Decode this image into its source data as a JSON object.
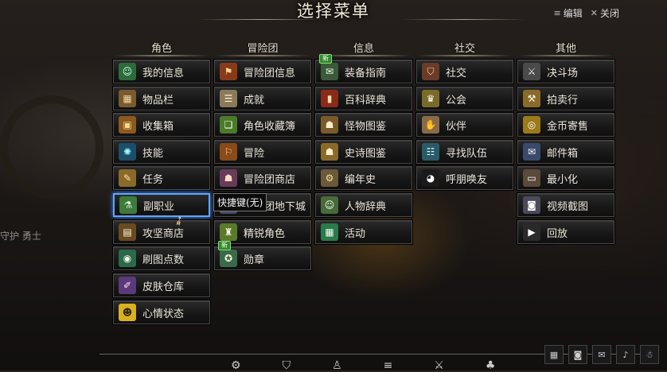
{
  "header": {
    "title": "选择菜单",
    "edit_label": "编辑",
    "close_label": "关闭"
  },
  "columns": [
    {
      "title": "角色"
    },
    {
      "title": "冒险团"
    },
    {
      "title": "信息"
    },
    {
      "title": "社交"
    },
    {
      "title": "其他"
    }
  ],
  "menu": {
    "character": [
      {
        "label": "我的信息",
        "icon": "person-icon"
      },
      {
        "label": "物品栏",
        "icon": "inventory-icon"
      },
      {
        "label": "收集箱",
        "icon": "chest-icon"
      },
      {
        "label": "技能",
        "icon": "skill-icon"
      },
      {
        "label": "任务",
        "icon": "quest-icon"
      },
      {
        "label": "副职业",
        "icon": "potion-icon"
      },
      {
        "label": "攻坚商店",
        "icon": "shop-icon"
      },
      {
        "label": "刷图点数",
        "icon": "points-icon"
      },
      {
        "label": "皮肤仓库",
        "icon": "brush-icon"
      },
      {
        "label": "心情状态",
        "icon": "emoji-icon"
      }
    ],
    "adventure": [
      {
        "label": "冒险团信息",
        "icon": "banner-icon"
      },
      {
        "label": "成就",
        "icon": "scroll-icon"
      },
      {
        "label": "角色收藏簿",
        "icon": "cards-icon"
      },
      {
        "label": "冒险",
        "icon": "flag-icon"
      },
      {
        "label": "冒险团商店",
        "icon": "merchant-icon"
      },
      {
        "label": "冒险团地下城",
        "icon": "dungeon-icon"
      },
      {
        "label": "精锐角色",
        "icon": "elite-icon"
      },
      {
        "label": "勋章",
        "icon": "medal-icon"
      }
    ],
    "info": [
      {
        "label": "装备指南",
        "icon": "guide-icon"
      },
      {
        "label": "百科辞典",
        "icon": "encyclopedia-icon"
      },
      {
        "label": "怪物图鉴",
        "icon": "monster-book-icon"
      },
      {
        "label": "史诗图鉴",
        "icon": "epic-book-icon"
      },
      {
        "label": "编年史",
        "icon": "chronicle-icon"
      },
      {
        "label": "人物辞典",
        "icon": "people-book-icon"
      },
      {
        "label": "活动",
        "icon": "calendar-icon"
      }
    ],
    "social": [
      {
        "label": "社交",
        "icon": "social-icon"
      },
      {
        "label": "公会",
        "icon": "guild-icon"
      },
      {
        "label": "伙伴",
        "icon": "handshake-icon"
      },
      {
        "label": "寻找队伍",
        "icon": "party-icon"
      },
      {
        "label": "呼朋唤友",
        "icon": "penguin-icon"
      }
    ],
    "other": [
      {
        "label": "决斗场",
        "icon": "swords-icon"
      },
      {
        "label": "拍卖行",
        "icon": "gavel-icon"
      },
      {
        "label": "金币寄售",
        "icon": "coins-icon"
      },
      {
        "label": "邮件箱",
        "icon": "mail-icon"
      },
      {
        "label": "最小化",
        "icon": "minimize-icon"
      },
      {
        "label": "视频截图",
        "icon": "camera-icon"
      },
      {
        "label": "回放",
        "icon": "replay-icon"
      }
    ]
  },
  "badges": {
    "new": "新"
  },
  "tooltip": "快捷键(无)",
  "background_text": {
    "left_name": "守护 勇士"
  },
  "colors": {
    "active_border": "#5fa6ff",
    "new_badge": "#2f8a2a"
  }
}
